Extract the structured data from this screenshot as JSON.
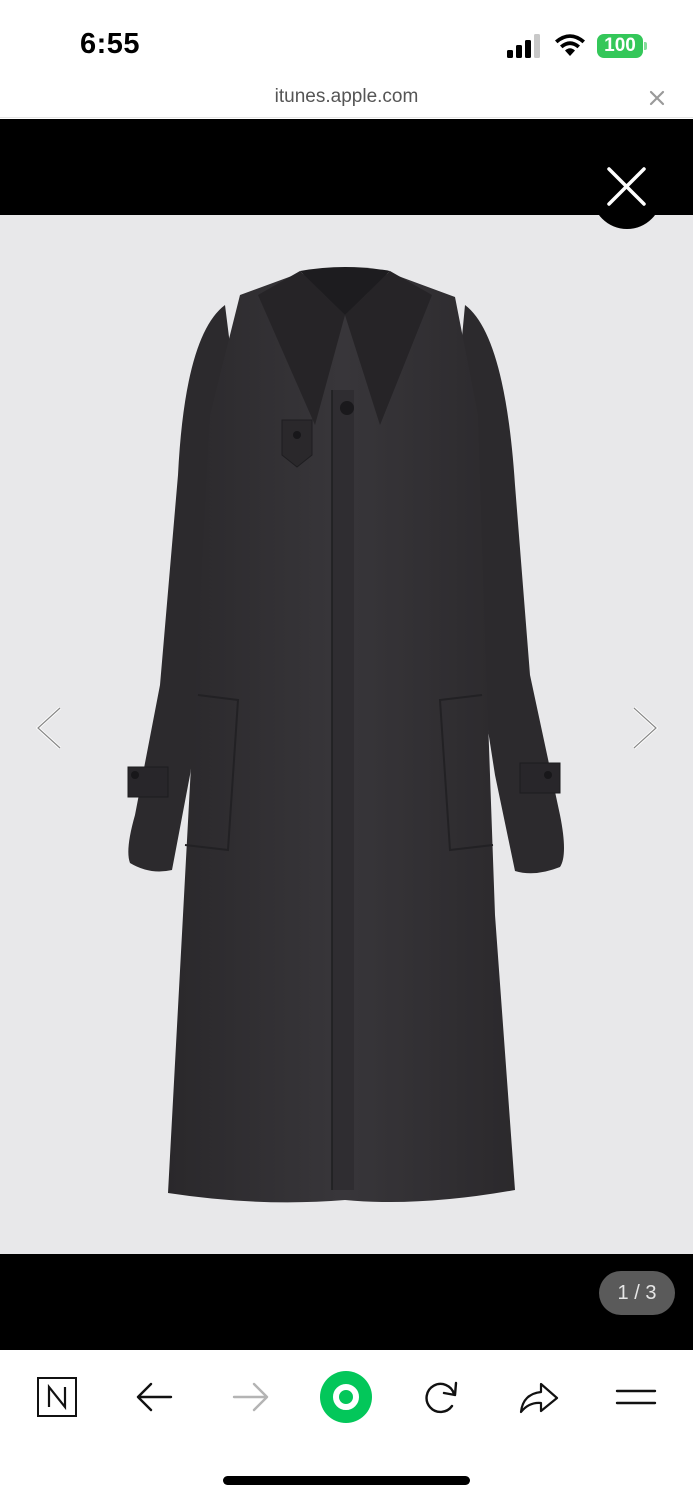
{
  "status_bar": {
    "time": "6:55",
    "battery": "100",
    "battery_color": "#34c759"
  },
  "url_bar": {
    "domain": "itunes.apple.com",
    "close_icon": "close-icon"
  },
  "viewer": {
    "background": "#000000",
    "photo_background": "#e8e8ea",
    "counter": "1 / 3",
    "close_icon": "close-icon",
    "prev_icon": "chevron-left-icon",
    "next_icon": "chevron-right-icon"
  },
  "toolbar": {
    "items": [
      {
        "icon": "naver-n-icon"
      },
      {
        "icon": "arrow-back-icon"
      },
      {
        "icon": "arrow-forward-icon"
      },
      {
        "icon": "green-home-icon",
        "color": "#03c75a"
      },
      {
        "icon": "refresh-icon"
      },
      {
        "icon": "share-icon"
      },
      {
        "icon": "menu-icon"
      }
    ]
  }
}
